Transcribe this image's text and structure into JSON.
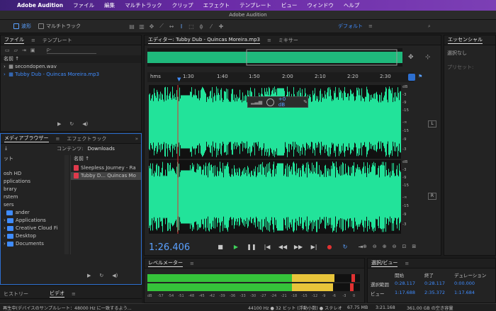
{
  "menubar": {
    "app": "Adobe Audition",
    "items": [
      "ファイル",
      "編集",
      "マルチトラック",
      "クリップ",
      "エフェクト",
      "テンプレート",
      "ビュー",
      "ウィンドウ",
      "ヘルプ"
    ]
  },
  "window_title": "Adobe Audition",
  "toolbar": {
    "waveform": "波形",
    "multitrack": "マルチトラック",
    "workspace": "デフォルト"
  },
  "files_panel": {
    "tabs": [
      "ファイル",
      "テンプレート"
    ],
    "search_placeholder": "ρ-",
    "name_col": "名前 ↑",
    "files": [
      "secondopen.wav",
      "Tubby Dub - Quincas Moreira.mp3"
    ]
  },
  "media_browser": {
    "tabs": [
      "メディアブラウザー",
      "エフェクトラック"
    ],
    "contents_label": "コンテンツ:",
    "contents_value": "Downloads",
    "name_col": "名前 ↑",
    "tree": [
      "ット",
      "osh HD",
      "pplications",
      "brary",
      "rstem",
      "sers",
      "ander",
      "Applications",
      "Creative Cloud Fi",
      "Desktop",
      "Documents"
    ],
    "files": [
      "Sleepless Journey - Ra",
      "Tubby D... Quincas Mo"
    ]
  },
  "bottom_left_tabs": [
    "ヒストリー",
    "ビデオ"
  ],
  "editor": {
    "tabs": [
      "エディター: Tubby Dub - Quincas Moreira.mp3",
      "ミキサー"
    ],
    "ruler_unit": "hms",
    "ruler_ticks": [
      "1:30",
      "1:40",
      "1:50",
      "2:00",
      "2:10",
      "2:20",
      "2:30"
    ],
    "gain": "+0 dB",
    "db_scale": [
      "dB",
      "-3",
      "-9",
      "-15",
      "-∞",
      "-15",
      "-9",
      "-3"
    ],
    "channels": [
      "L",
      "R"
    ],
    "timecode": "1:26.406"
  },
  "essential_sound": {
    "title": "エッセンシャル",
    "sub": "選択なし",
    "preset": "プリセット:"
  },
  "level_meter": {
    "title": "レベルメーター",
    "scale": [
      "dB",
      "-57",
      "-54",
      "-51",
      "-48",
      "-45",
      "-42",
      "-39",
      "-36",
      "-33",
      "-30",
      "-27",
      "-24",
      "-21",
      "-18",
      "-15",
      "-12",
      "-9",
      "-6",
      "-3",
      "0"
    ]
  },
  "selection_view": {
    "title": "選択/ビュー",
    "cols": [
      "開始",
      "終了",
      "デュレーション"
    ],
    "rows": [
      {
        "label": "選択範囲",
        "start": "0:28.117",
        "end": "0:28.117",
        "dur": "0:00.000"
      },
      {
        "label": "ビュー",
        "start": "1:17.688",
        "end": "2:35.372",
        "dur": "1:17.684"
      }
    ]
  },
  "status": {
    "left": "再生中(デバイスのサンプルレート：48000 Hz に一致するよう...",
    "format": "44100 Hz ● 32 ビット (浮動小数) ● ステレオ",
    "size": "67.75 MB",
    "dur": "3:21.168",
    "free": "361.00 GB の空き容量"
  },
  "colors": {
    "wave": "#22e39a",
    "accent": "#3f8cff",
    "meter_green": "#35c33a",
    "meter_yellow": "#e8c43a",
    "meter_red": "#e03232"
  }
}
